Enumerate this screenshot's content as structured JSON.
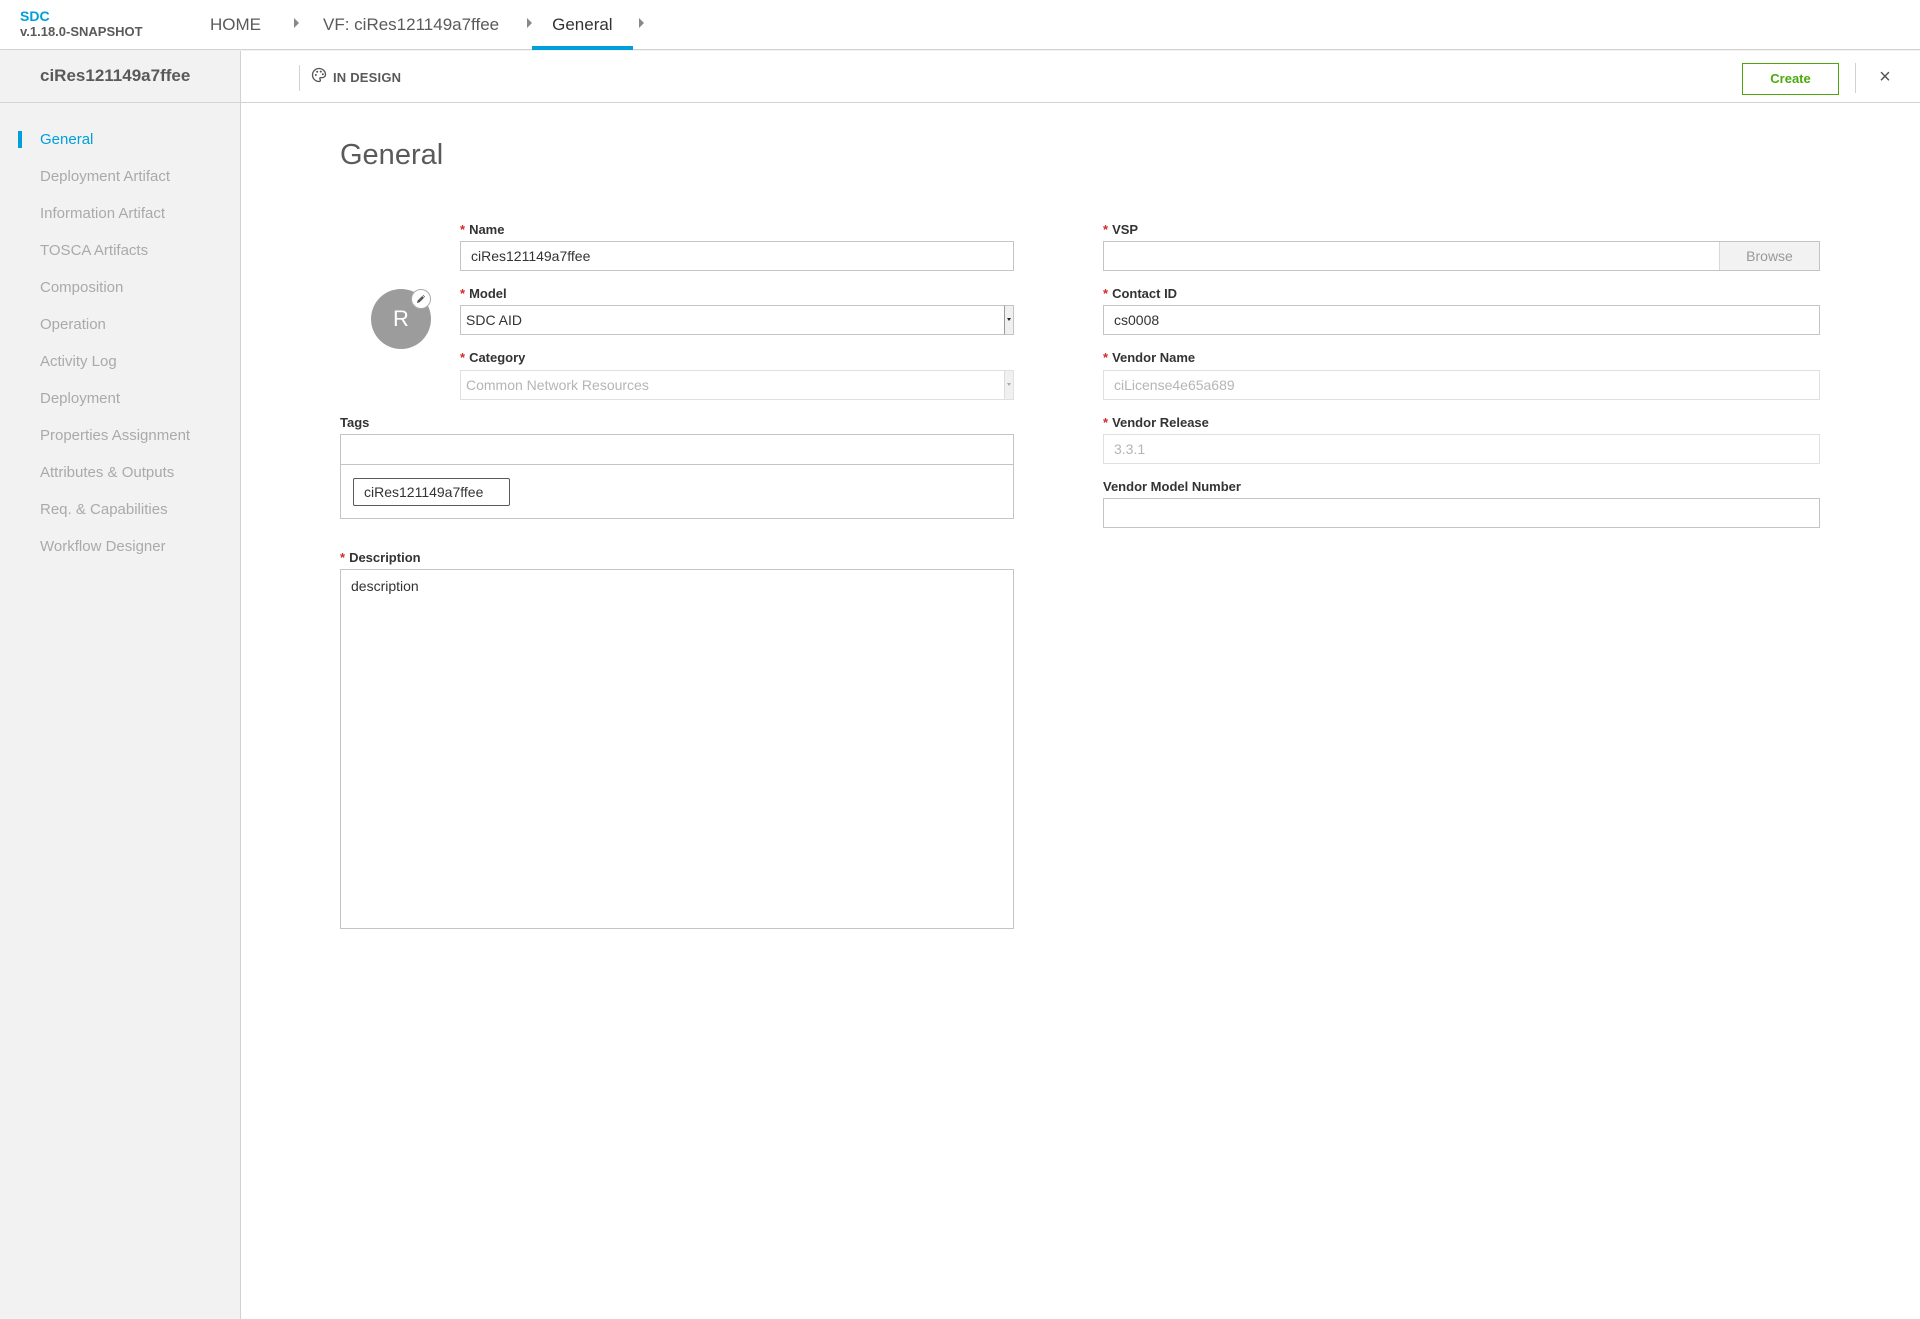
{
  "header": {
    "app_name": "SDC",
    "version": "v.1.18.0-SNAPSHOT",
    "breadcrumbs": [
      "HOME",
      "VF: ciRes121149a7ffee",
      "General"
    ]
  },
  "sidebar": {
    "title": "ciRes121149a7ffee",
    "items": [
      {
        "label": "General",
        "active": true
      },
      {
        "label": "Deployment Artifact"
      },
      {
        "label": "Information Artifact"
      },
      {
        "label": "TOSCA Artifacts"
      },
      {
        "label": "Composition"
      },
      {
        "label": "Operation"
      },
      {
        "label": "Activity Log"
      },
      {
        "label": "Deployment"
      },
      {
        "label": "Properties Assignment"
      },
      {
        "label": "Attributes & Outputs"
      },
      {
        "label": "Req. & Capabilities"
      },
      {
        "label": "Workflow Designer"
      }
    ]
  },
  "subheader": {
    "status": "IN DESIGN",
    "create_label": "Create",
    "close_symbol": "×"
  },
  "main": {
    "title": "General",
    "avatar_letter": "R",
    "form": {
      "name": {
        "label": "Name",
        "value": "ciRes121149a7ffee"
      },
      "model": {
        "label": "Model",
        "value": "SDC AID"
      },
      "category": {
        "label": "Category",
        "value": "Common Network Resources"
      },
      "tags": {
        "label": "Tags",
        "chips": [
          "ciRes121149a7ffee"
        ]
      },
      "description": {
        "label": "Description",
        "value": "description"
      },
      "vsp": {
        "label": "VSP",
        "value": "",
        "browse_label": "Browse"
      },
      "contact_id": {
        "label": "Contact ID",
        "value": "cs0008"
      },
      "vendor_name": {
        "label": "Vendor Name",
        "value": "ciLicense4e65a689"
      },
      "vendor_release": {
        "label": "Vendor Release",
        "value": "3.3.1"
      },
      "vendor_model_number": {
        "label": "Vendor Model Number",
        "value": ""
      }
    }
  },
  "colors": {
    "accent": "#009fdb",
    "create": "#4ca90c",
    "required": "#cf2a2a"
  }
}
